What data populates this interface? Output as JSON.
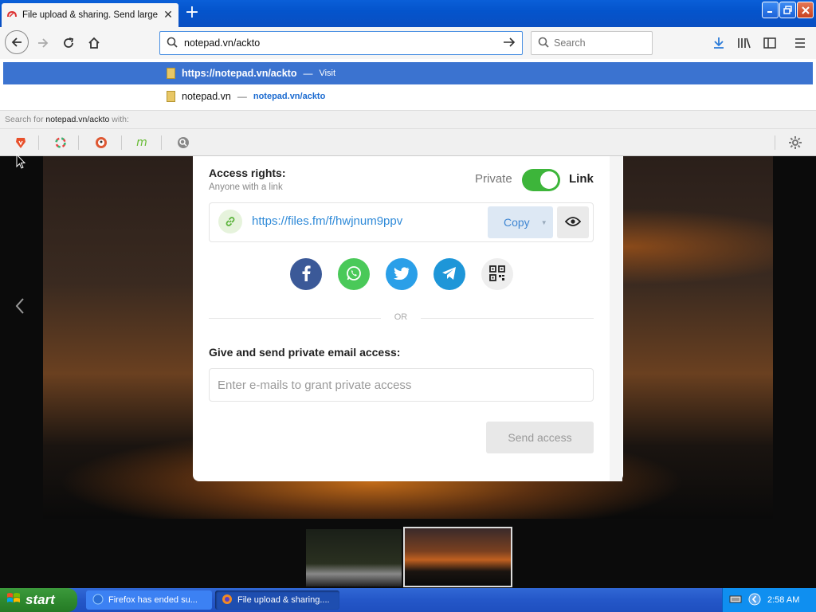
{
  "browser": {
    "tab_title": "File upload & sharing. Send large p",
    "tab_close": "✕",
    "new_tab": "+",
    "url": "notepad.vn/ackto",
    "search_placeholder": "Search"
  },
  "dropdown": {
    "first": {
      "url": "https://notepad.vn/ackto",
      "separator": "—",
      "action": "Visit"
    },
    "second": {
      "title": "notepad.vn",
      "separator": "—",
      "url": "notepad.vn/ackto"
    },
    "search_with_prefix": "Search for",
    "search_with_query": "notepad.vn/ackto",
    "search_with_suffix": "with:"
  },
  "share": {
    "access_title": "Access rights:",
    "access_subtitle": "Anyone with a link",
    "private_label": "Private",
    "link_label": "Link",
    "toggle_on": true,
    "link_url": "https://files.fm/f/hwjnum9ppv",
    "copy_label": "Copy",
    "or_label": "OR",
    "email_title": "Give and send private email access:",
    "email_placeholder": "Enter e-mails to grant private access",
    "send_label": "Send access"
  },
  "colors": {
    "facebook": "#3b5998",
    "whatsapp": "#4ac959",
    "twitter": "#2a9fe8",
    "telegram": "#1e96d8",
    "toggle_green": "#3db53a",
    "link_blue": "#2f8ad8"
  },
  "taskbar": {
    "start_label": "start",
    "task1": "Firefox has ended su...",
    "task2": "File upload & sharing....",
    "clock": "2:58 AM"
  }
}
